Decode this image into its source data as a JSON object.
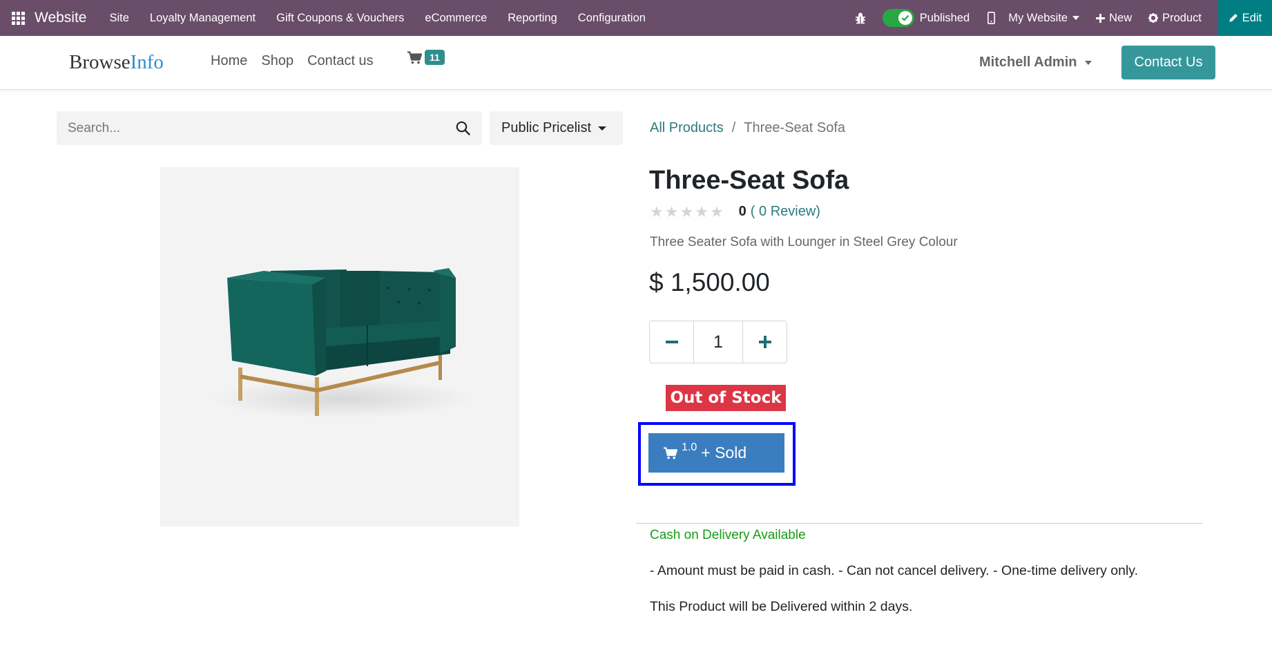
{
  "admin_bar": {
    "app_name": "Website",
    "menu": [
      "Site",
      "Loyalty Management",
      "Gift Coupons & Vouchers",
      "eCommerce",
      "Reporting",
      "Configuration"
    ],
    "published_label": "Published",
    "website_selector": "My Website",
    "new_label": "New",
    "product_label": "Product",
    "edit_label": "Edit",
    "colors": {
      "background": "#6a4d68",
      "edit_background": "#017e84",
      "toggle_on": "#28a745"
    }
  },
  "header": {
    "logo_part1": "Browse",
    "logo_part2": "Info",
    "nav": [
      "Home",
      "Shop",
      "Contact us"
    ],
    "cart_count": "11",
    "user_name": "Mitchell Admin",
    "contact_button": "Contact Us",
    "icons": {
      "cart": "shopping-cart-icon"
    }
  },
  "search": {
    "placeholder": "Search...",
    "value": "",
    "pricelist": "Public Pricelist"
  },
  "breadcrumb": {
    "parent": "All Products",
    "separator": "/",
    "current": "Three-Seat Sofa"
  },
  "product": {
    "name": "Three-Seat Sofa",
    "rating_stars": 0,
    "rating_count": "0",
    "review_link": "( 0 Review)",
    "description": "Three Seater Sofa with Lounger in Steel Grey Colour",
    "price": "$ 1,500.00",
    "quantity": "1",
    "stock_status": "Out of Stock",
    "sold_qty": "1.0",
    "sold_label": "+ Sold",
    "image_name": "green-sofa-image",
    "colors": {
      "accent": "#36979b",
      "stock_badge": "#dc3545",
      "sold_button": "#3a7ebf",
      "highlight": "#0000ff"
    }
  },
  "delivery_info": {
    "cod": "Cash on Delivery Available",
    "terms": "- Amount must be paid in cash. - Can not cancel delivery. - One-time delivery only.",
    "delivery_text": "This Product will be Delivered within 2 days."
  }
}
